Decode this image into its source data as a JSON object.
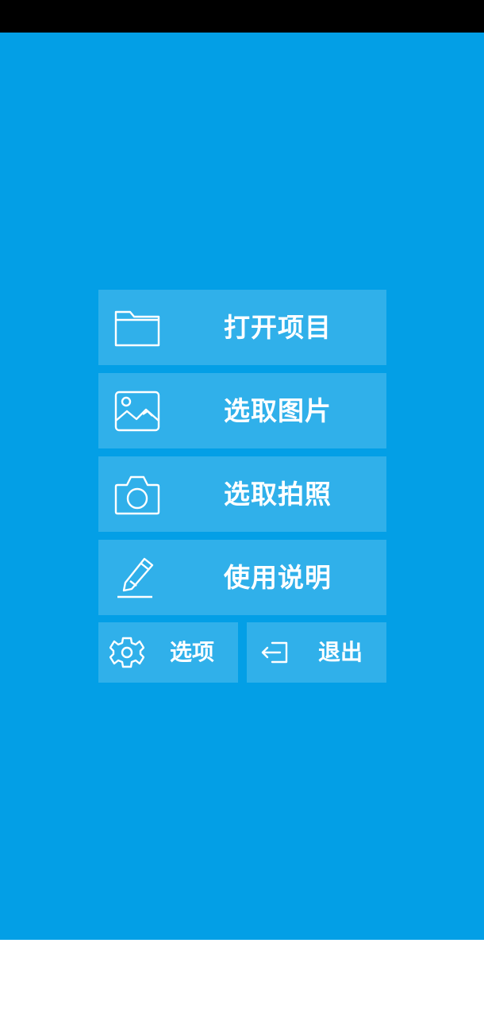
{
  "colors": {
    "background": "#039fe6",
    "button_fill": "rgba(255,255,255,0.18)",
    "text": "#ffffff",
    "status_bar": "#000000"
  },
  "menu": {
    "open_project": {
      "label": "打开项目",
      "icon": "folder-icon"
    },
    "choose_image": {
      "label": "选取图片",
      "icon": "image-icon"
    },
    "take_photo": {
      "label": "选取拍照",
      "icon": "camera-icon"
    },
    "instructions": {
      "label": "使用说明",
      "icon": "pen-icon"
    },
    "options": {
      "label": "选项",
      "icon": "gear-icon"
    },
    "exit": {
      "label": "退出",
      "icon": "exit-icon"
    }
  }
}
